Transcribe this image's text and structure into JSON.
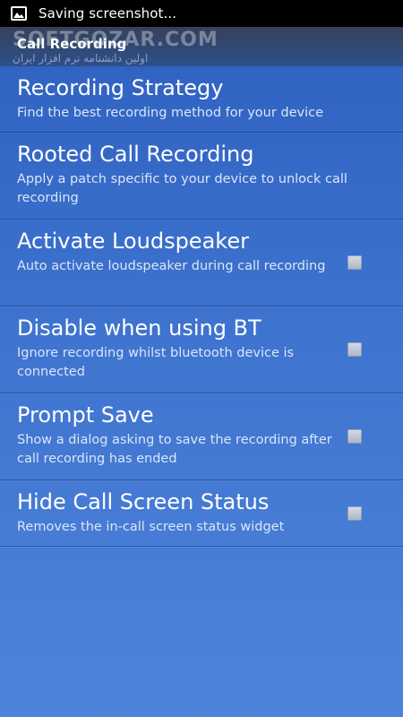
{
  "status_bar": {
    "text": "Saving screenshot..."
  },
  "action_bar": {
    "title": "Call Recording",
    "watermark": "SOFTGOZAR.COM",
    "watermark_sub": "اولین دانشنامه نرم افزار ایران"
  },
  "preferences": [
    {
      "title": "Recording Strategy",
      "summary": "Find the best recording method for your device",
      "checkbox": false
    },
    {
      "title": "Rooted Call Recording",
      "summary": "Apply a patch specific to your device to unlock call recording",
      "checkbox": false
    },
    {
      "title": "Activate Loudspeaker",
      "summary": "Auto activate loudspeaker during call recording",
      "checkbox": true,
      "checked": false
    },
    {
      "title": "Disable when using BT",
      "summary": "Ignore recording whilst bluetooth device is connected",
      "checkbox": true,
      "checked": false
    },
    {
      "title": "Prompt Save",
      "summary": "Show a dialog asking to save the recording after call recording has ended",
      "checkbox": true,
      "checked": false
    },
    {
      "title": "Hide Call Screen Status",
      "summary": "Removes the in-call screen status widget",
      "checkbox": true,
      "checked": false
    }
  ]
}
